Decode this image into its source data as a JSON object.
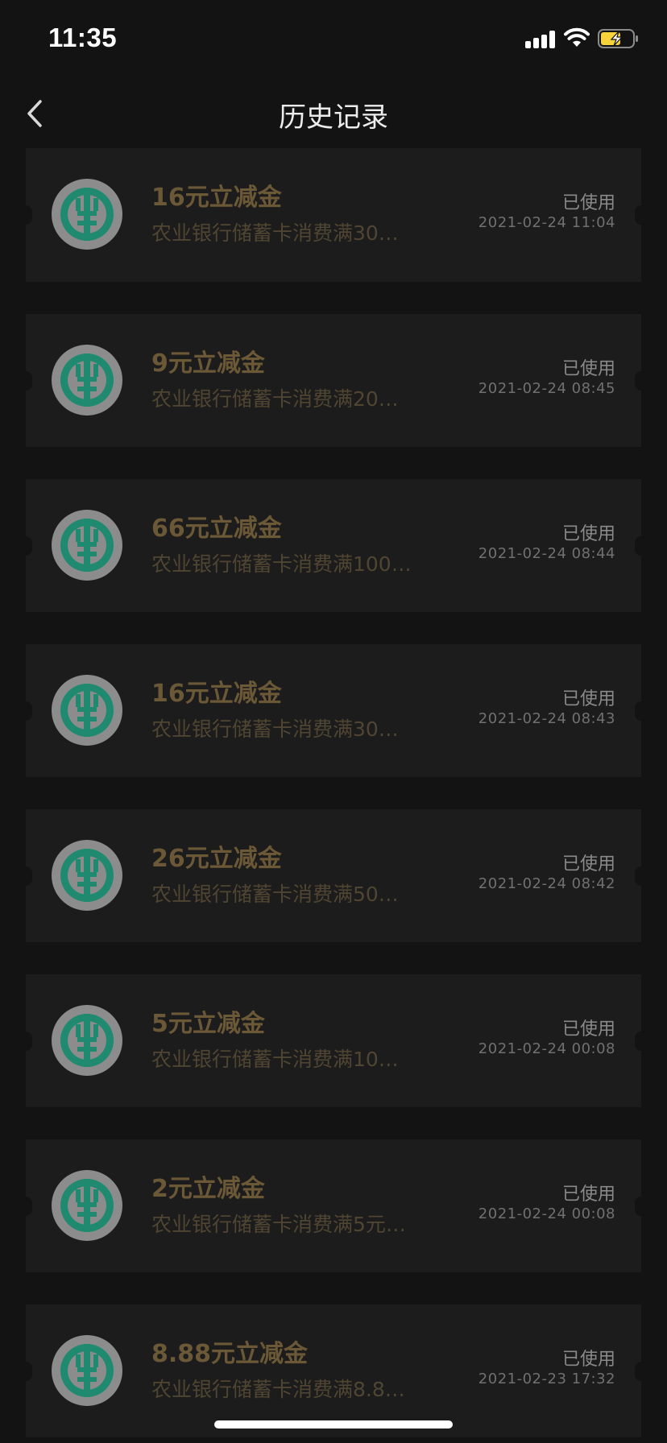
{
  "status_bar": {
    "time": "11:35"
  },
  "nav": {
    "title": "历史记录"
  },
  "coupons": [
    {
      "amount": "16元立减金",
      "desc": "农业银行储蓄卡消费满30…",
      "status": "已使用",
      "date": "2021-02-24 11:04"
    },
    {
      "amount": "9元立减金",
      "desc": "农业银行储蓄卡消费满20…",
      "status": "已使用",
      "date": "2021-02-24 08:45"
    },
    {
      "amount": "66元立减金",
      "desc": "农业银行储蓄卡消费满100…",
      "status": "已使用",
      "date": "2021-02-24 08:44"
    },
    {
      "amount": "16元立减金",
      "desc": "农业银行储蓄卡消费满30…",
      "status": "已使用",
      "date": "2021-02-24 08:43"
    },
    {
      "amount": "26元立减金",
      "desc": "农业银行储蓄卡消费满50…",
      "status": "已使用",
      "date": "2021-02-24 08:42"
    },
    {
      "amount": "5元立减金",
      "desc": "农业银行储蓄卡消费满10…",
      "status": "已使用",
      "date": "2021-02-24 00:08"
    },
    {
      "amount": "2元立减金",
      "desc": "农业银行储蓄卡消费满5元…",
      "status": "已使用",
      "date": "2021-02-24 00:08"
    },
    {
      "amount": "8.88元立减金",
      "desc": "农业银行储蓄卡消费满8.8…",
      "status": "已使用",
      "date": "2021-02-23 17:32"
    }
  ],
  "colors": {
    "background": "#131313",
    "card": "#1c1c1c",
    "amount_text": "#6b5837",
    "logo_green": "#1f8a6f"
  }
}
